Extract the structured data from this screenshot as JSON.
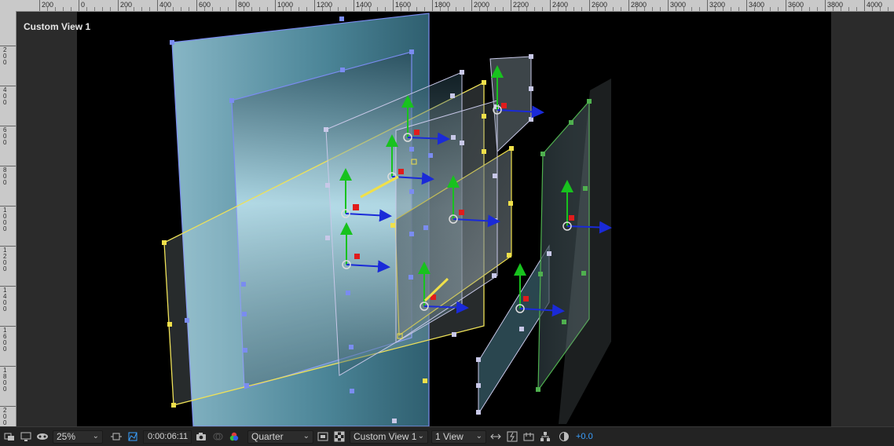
{
  "viewport": {
    "view_title": "Custom View 1"
  },
  "ruler": {
    "top_labels": [
      "200",
      "0",
      "200",
      "400",
      "600",
      "800",
      "1000",
      "1200",
      "1400",
      "1600",
      "1800",
      "2000",
      "2200",
      "2400",
      "2600",
      "2800",
      "3000",
      "3200",
      "3400",
      "3600",
      "3800",
      "4000"
    ],
    "left_labels": [
      "200",
      "400",
      "600",
      "800",
      "1000",
      "1200",
      "1400",
      "1600",
      "1800",
      "2000"
    ]
  },
  "toolbar": {
    "zoom": "25%",
    "timecode": "0:00:06:11",
    "resolution": "Quarter",
    "view": "Custom View 1",
    "view_layout": "1 View",
    "exposure": "+0.0"
  },
  "colors": {
    "accent_blue": "#3aa0ff",
    "layer_blue": "#7a8cf0",
    "layer_yellow": "#f0e04a",
    "layer_lavender": "#c8c8e8",
    "layer_green": "#4fb04f",
    "axis_x": "#1a2ad8",
    "axis_y": "#18c21e",
    "axis_z": "#e01c1c"
  },
  "icons": [
    "comp-flowchart-icon",
    "monitor-icon",
    "mask-icon",
    "region-of-interest-icon",
    "transparency-grid-icon",
    "camera-icon",
    "color-channel-icon",
    "fast-preview-icon",
    "toggle-transparency-icon",
    "timeline-icon",
    "flowchart-icon",
    "reset-exposure-icon"
  ]
}
